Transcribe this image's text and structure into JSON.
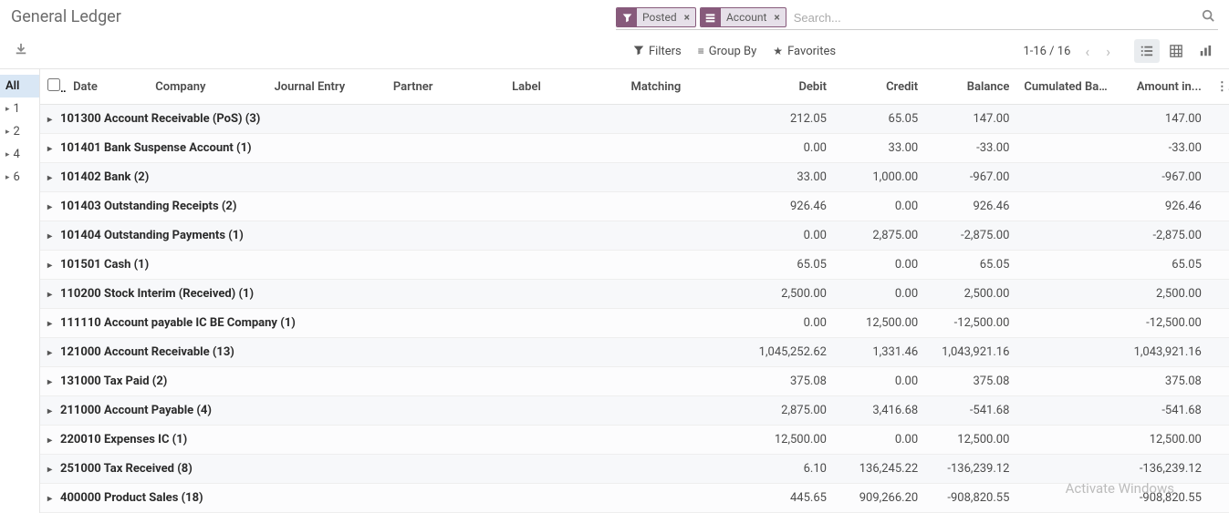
{
  "header": {
    "title": "General Ledger",
    "facets": [
      {
        "icon": "filter",
        "label": "Posted"
      },
      {
        "icon": "group",
        "label": "Account"
      }
    ],
    "search_placeholder": "Search..."
  },
  "controls": {
    "filters_label": "Filters",
    "groupby_label": "Group By",
    "favorites_label": "Favorites",
    "pager": "1-16 / 16"
  },
  "sidebar": {
    "items": [
      {
        "label": "All",
        "active": true,
        "caret": false
      },
      {
        "label": "1",
        "active": false,
        "caret": true
      },
      {
        "label": "2",
        "active": false,
        "caret": true
      },
      {
        "label": "4",
        "active": false,
        "caret": true
      },
      {
        "label": "6",
        "active": false,
        "caret": true
      }
    ]
  },
  "columns": {
    "date": "Date",
    "company": "Company",
    "journal": "Journal Entry",
    "partner": "Partner",
    "label": "Label",
    "matching": "Matching",
    "debit": "Debit",
    "credit": "Credit",
    "balance": "Balance",
    "cumulated": "Cumulated Bal...",
    "amount": "Amount in..."
  },
  "rows": [
    {
      "label": "101300 Account Receivable (PoS) (3)",
      "debit": "212.05",
      "credit": "65.05",
      "balance": "147.00",
      "cumulated": "",
      "amount": "147.00"
    },
    {
      "label": "101401 Bank Suspense Account (1)",
      "debit": "0.00",
      "credit": "33.00",
      "balance": "-33.00",
      "cumulated": "",
      "amount": "-33.00"
    },
    {
      "label": "101402 Bank (2)",
      "debit": "33.00",
      "credit": "1,000.00",
      "balance": "-967.00",
      "cumulated": "",
      "amount": "-967.00"
    },
    {
      "label": "101403 Outstanding Receipts (2)",
      "debit": "926.46",
      "credit": "0.00",
      "balance": "926.46",
      "cumulated": "",
      "amount": "926.46"
    },
    {
      "label": "101404 Outstanding Payments (1)",
      "debit": "0.00",
      "credit": "2,875.00",
      "balance": "-2,875.00",
      "cumulated": "",
      "amount": "-2,875.00"
    },
    {
      "label": "101501 Cash (1)",
      "debit": "65.05",
      "credit": "0.00",
      "balance": "65.05",
      "cumulated": "",
      "amount": "65.05"
    },
    {
      "label": "110200 Stock Interim (Received) (1)",
      "debit": "2,500.00",
      "credit": "0.00",
      "balance": "2,500.00",
      "cumulated": "",
      "amount": "2,500.00"
    },
    {
      "label": "111110 Account payable IC BE Company (1)",
      "debit": "0.00",
      "credit": "12,500.00",
      "balance": "-12,500.00",
      "cumulated": "",
      "amount": "-12,500.00"
    },
    {
      "label": "121000 Account Receivable (13)",
      "debit": "1,045,252.62",
      "credit": "1,331.46",
      "balance": "1,043,921.16",
      "cumulated": "",
      "amount": "1,043,921.16"
    },
    {
      "label": "131000 Tax Paid (2)",
      "debit": "375.08",
      "credit": "0.00",
      "balance": "375.08",
      "cumulated": "",
      "amount": "375.08"
    },
    {
      "label": "211000 Account Payable (4)",
      "debit": "2,875.00",
      "credit": "3,416.68",
      "balance": "-541.68",
      "cumulated": "",
      "amount": "-541.68"
    },
    {
      "label": "220010 Expenses IC (1)",
      "debit": "12,500.00",
      "credit": "0.00",
      "balance": "12,500.00",
      "cumulated": "",
      "amount": "12,500.00"
    },
    {
      "label": "251000 Tax Received (8)",
      "debit": "6.10",
      "credit": "136,245.22",
      "balance": "-136,239.12",
      "cumulated": "",
      "amount": "-136,239.12"
    },
    {
      "label": "400000 Product Sales (18)",
      "debit": "445.65",
      "credit": "909,266.20",
      "balance": "-908,820.55",
      "cumulated": "",
      "amount": "-908,820.55"
    }
  ],
  "watermark": "Activate Windows"
}
